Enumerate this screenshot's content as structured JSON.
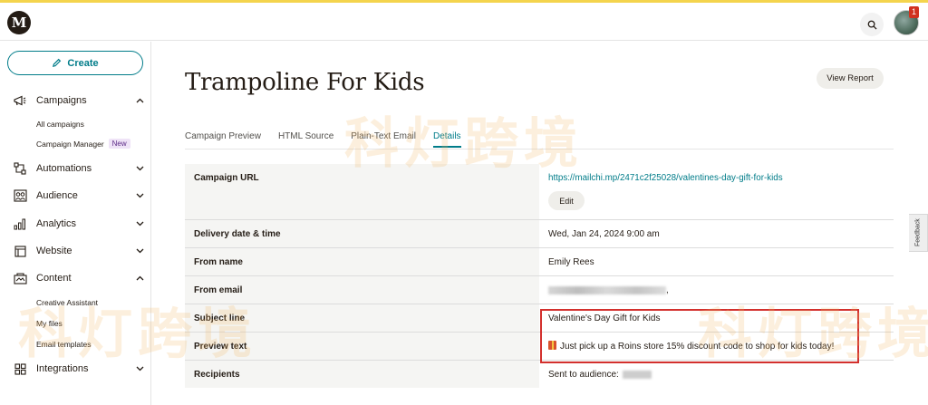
{
  "app": {
    "logo_glyph": "M",
    "notification_count": "1"
  },
  "sidebar": {
    "create_label": "Create",
    "items": [
      {
        "label": "Campaigns",
        "icon": "megaphone-icon",
        "expanded": true
      },
      {
        "label": "Automations",
        "icon": "automation-icon",
        "expanded": false
      },
      {
        "label": "Audience",
        "icon": "audience-icon",
        "expanded": false
      },
      {
        "label": "Analytics",
        "icon": "analytics-icon",
        "expanded": false
      },
      {
        "label": "Website",
        "icon": "website-icon",
        "expanded": false
      },
      {
        "label": "Content",
        "icon": "content-icon",
        "expanded": true
      },
      {
        "label": "Integrations",
        "icon": "integrations-icon",
        "expanded": false
      }
    ],
    "campaigns_sub": [
      {
        "label": "All campaigns"
      },
      {
        "label": "Campaign Manager",
        "badge": "New"
      }
    ],
    "content_sub": [
      {
        "label": "Creative Assistant"
      },
      {
        "label": "My files"
      },
      {
        "label": "Email templates"
      }
    ]
  },
  "main": {
    "title": "Trampoline For Kids",
    "view_report_label": "View Report",
    "tabs": [
      {
        "label": "Campaign Preview",
        "active": false
      },
      {
        "label": "HTML Source",
        "active": false
      },
      {
        "label": "Plain-Text Email",
        "active": false
      },
      {
        "label": "Details",
        "active": true
      }
    ],
    "details": {
      "campaign_url": {
        "label": "Campaign URL",
        "value": "https://mailchi.mp/2471c2f25028/valentines-day-gift-for-kids",
        "edit_label": "Edit"
      },
      "delivery": {
        "label": "Delivery date & time",
        "value": "Wed, Jan 24, 2024 9:00 am"
      },
      "from_name": {
        "label": "From name",
        "value": "Emily Rees"
      },
      "from_email": {
        "label": "From email",
        "value_suffix": ","
      },
      "subject": {
        "label": "Subject line",
        "value": "Valentine's Day Gift for Kids"
      },
      "preview": {
        "label": "Preview text",
        "value": "Just pick up a Roins store 15% discount code to shop for kids today!"
      },
      "recipients": {
        "label": "Recipients",
        "value": "Sent to audience:"
      }
    }
  },
  "feedback_label": "Feedback",
  "watermark": "科灯跨境",
  "colors": {
    "accent": "#007c89",
    "highlight": "#d3302d",
    "top_bar": "#f4d44d"
  }
}
